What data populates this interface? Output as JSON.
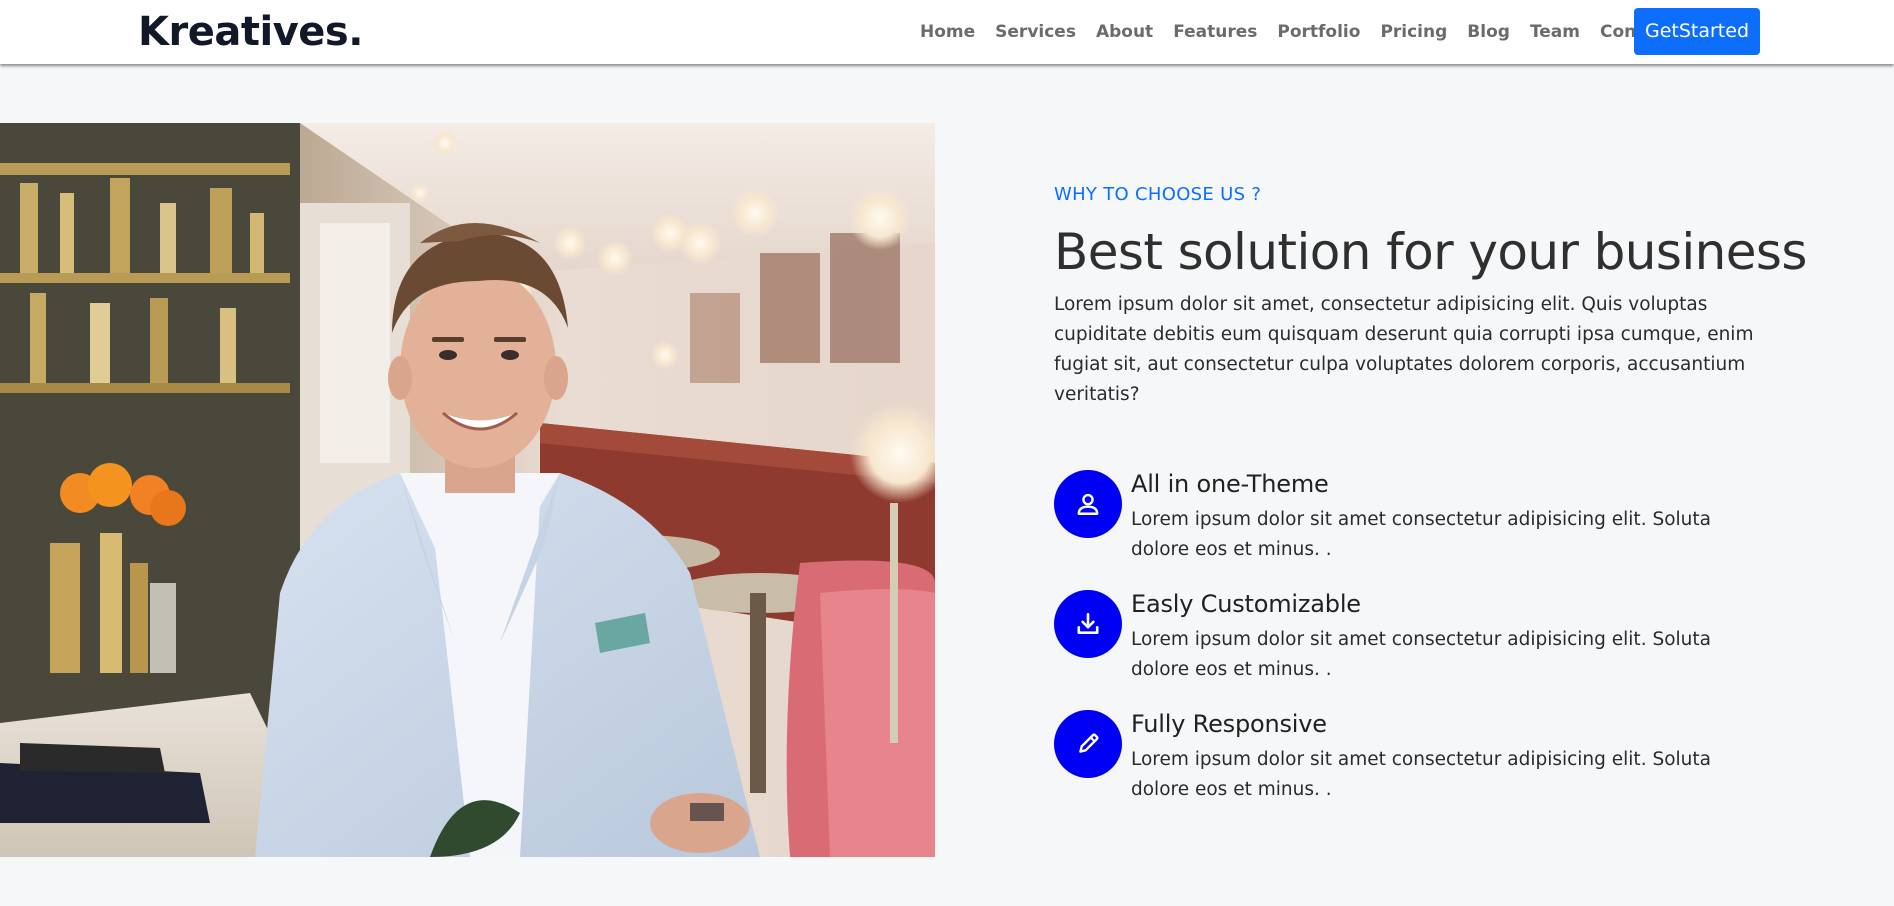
{
  "navbar": {
    "brand": "Kreatives.",
    "links": [
      "Home",
      "Services",
      "About",
      "Features",
      "Portfolio",
      "Pricing",
      "Blog",
      "Team",
      "Contact"
    ],
    "cta_label": "GetStarted"
  },
  "hero": {
    "image": "man-in-light-blue-blazer-smiling-in-restaurant-photo"
  },
  "section": {
    "eyebrow": "WHY TO CHOOSE US ?",
    "title": "Best solution for your business",
    "description": "Lorem ipsum dolor sit amet, consectetur adipisicing elit. Quis voluptas cupiditate debitis eum quisquam deserunt quia corrupti ipsa cumque, enim fugiat sit, aut consectetur culpa voluptates dolorem corporis, accusantium veritatis?",
    "features": [
      {
        "icon": "user-icon",
        "title": "All in one-Theme",
        "text": "Lorem ipsum dolor sit amet consectetur adipisicing elit. Soluta dolore eos et minus. ."
      },
      {
        "icon": "download-icon",
        "title": "Easly Customizable",
        "text": "Lorem ipsum dolor sit amet consectetur adipisicing elit. Soluta dolore eos et minus. ."
      },
      {
        "icon": "pencil-icon",
        "title": "Fully Responsive",
        "text": "Lorem ipsum dolor sit amet consectetur adipisicing elit. Soluta dolore eos et minus. ."
      }
    ]
  },
  "colors": {
    "accent": "#0d6efd",
    "icon_circle": "#0000f5",
    "background": "#f6f7f9",
    "brand_text": "#111827"
  }
}
